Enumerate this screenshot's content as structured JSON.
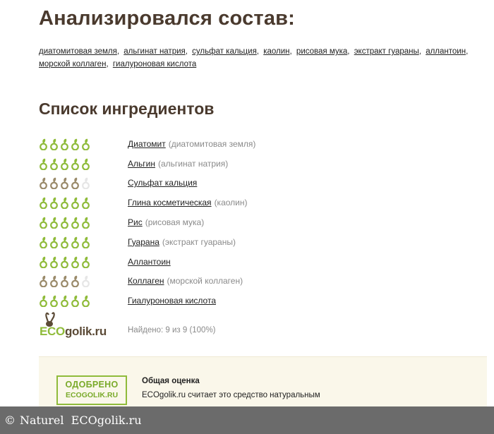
{
  "heading": "Анализировался состав:",
  "composition": [
    "диатомитовая земля",
    "альгинат натрия",
    "сульфат кальция",
    "каолин",
    "рисовая мука",
    "экстракт гуараны",
    "аллантоин",
    "морской коллаген",
    "гиалуроновая кислота"
  ],
  "ingredients_heading": "Список ингредиентов",
  "ingredients": [
    {
      "name": "Диатомит",
      "alt": "(диатомитовая земля)",
      "rating": 5,
      "total": 5
    },
    {
      "name": "Альгин",
      "alt": "(альгинат натрия)",
      "rating": 5,
      "total": 5
    },
    {
      "name": "Сульфат кальция",
      "alt": "",
      "rating": 4,
      "total": 5
    },
    {
      "name": "Глина косметическая",
      "alt": "(каолин)",
      "rating": 5,
      "total": 5
    },
    {
      "name": "Рис",
      "alt": "(рисовая мука)",
      "rating": 5,
      "total": 5
    },
    {
      "name": "Гуарана",
      "alt": "(экстракт гуараны)",
      "rating": 5,
      "total": 5
    },
    {
      "name": "Аллантоин",
      "alt": "",
      "rating": 5,
      "total": 5
    },
    {
      "name": "Коллаген",
      "alt": "(морской коллаген)",
      "rating": 4,
      "total": 5
    },
    {
      "name": "Гиалуроновая кислота",
      "alt": "",
      "rating": 5,
      "total": 5
    }
  ],
  "logo": {
    "text": "ECOgolik.ru",
    "icon": "rabbit-icon"
  },
  "found_text": "Найдено: 9 из 9 (100%)",
  "verdict": {
    "stamp_line1": "ОДОБРЕНО",
    "stamp_line2": "ECOGOLIK.RU",
    "title": "Общая оценка",
    "text": "ECOgolik.ru считает это средство натуральным"
  },
  "footer": {
    "copyright": "©",
    "text": "Naturel  ECOgolik.ru"
  },
  "colors": {
    "leaf_green": "#8fbb3a",
    "leaf_brown": "#9a8a6a",
    "leaf_empty": "#e6e6e6",
    "heading": "#4a3a2e",
    "muted": "#8a8a8a",
    "verdict_bg": "#faf7ea"
  }
}
